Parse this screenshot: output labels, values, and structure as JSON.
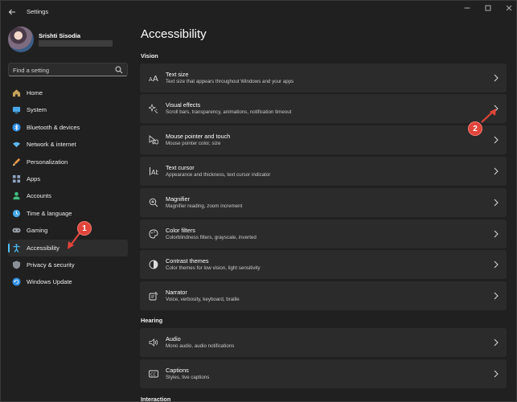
{
  "window": {
    "title": "Settings",
    "controls": {
      "minimize": "—",
      "maximize": "☐",
      "close": "✕"
    }
  },
  "sidebar": {
    "user": {
      "name": "Srishti Sisodia"
    },
    "search": {
      "placeholder": "Find a setting"
    },
    "items": [
      {
        "label": "Home",
        "icon": "home-icon",
        "color": "#c6a25a",
        "active": false
      },
      {
        "label": "System",
        "icon": "system-icon",
        "color": "#4aa8e8",
        "active": false
      },
      {
        "label": "Bluetooth & devices",
        "icon": "bluetooth-icon",
        "color": "#2f8fe6",
        "active": false
      },
      {
        "label": "Network & internet",
        "icon": "wifi-icon",
        "color": "#5fb6ef",
        "active": false
      },
      {
        "label": "Personalization",
        "icon": "brush-icon",
        "color": "#e79a4a",
        "active": false
      },
      {
        "label": "Apps",
        "icon": "apps-icon",
        "color": "#8fa4c2",
        "active": false
      },
      {
        "label": "Accounts",
        "icon": "person-icon",
        "color": "#3fbf7f",
        "active": false
      },
      {
        "label": "Time & language",
        "icon": "globe-clock-icon",
        "color": "#49a6e6",
        "active": false
      },
      {
        "label": "Gaming",
        "icon": "gamepad-icon",
        "color": "#9aa0a8",
        "active": false
      },
      {
        "label": "Accessibility",
        "icon": "accessibility-icon",
        "color": "#4cc2ff",
        "active": true
      },
      {
        "label": "Privacy & security",
        "icon": "shield-icon",
        "color": "#8c9099",
        "active": false
      },
      {
        "label": "Windows Update",
        "icon": "update-icon",
        "color": "#2f8fe6",
        "active": false
      }
    ]
  },
  "main": {
    "title": "Accessibility",
    "sections": [
      {
        "label": "Vision",
        "items": [
          {
            "title": "Text size",
            "subtitle": "Text size that appears throughout Windows and your apps",
            "icon": "text-size-icon"
          },
          {
            "title": "Visual effects",
            "subtitle": "Scroll bars, transparency, animations, notification timeout",
            "icon": "sparkle-icon"
          },
          {
            "title": "Mouse pointer and touch",
            "subtitle": "Mouse pointer color, size",
            "icon": "mouse-pointer-icon"
          },
          {
            "title": "Text cursor",
            "subtitle": "Appearance and thickness, text cursor indicator",
            "icon": "text-cursor-icon"
          },
          {
            "title": "Magnifier",
            "subtitle": "Magnifier reading, zoom increment",
            "icon": "magnifier-icon"
          },
          {
            "title": "Color filters",
            "subtitle": "Colorblindness filters, grayscale, inverted",
            "icon": "palette-icon"
          },
          {
            "title": "Contrast themes",
            "subtitle": "Color themes for low vision, light sensitivity",
            "icon": "contrast-icon"
          },
          {
            "title": "Narrator",
            "subtitle": "Voice, verbosity, keyboard, braille",
            "icon": "narrator-icon"
          }
        ]
      },
      {
        "label": "Hearing",
        "items": [
          {
            "title": "Audio",
            "subtitle": "Mono audio, audio notifications",
            "icon": "speaker-icon"
          },
          {
            "title": "Captions",
            "subtitle": "Styles, live captions",
            "icon": "captions-icon"
          }
        ]
      },
      {
        "label": "Interaction",
        "items": []
      }
    ]
  },
  "annotations": {
    "badge_1": "1",
    "badge_2": "2",
    "color": "#e0443a"
  }
}
